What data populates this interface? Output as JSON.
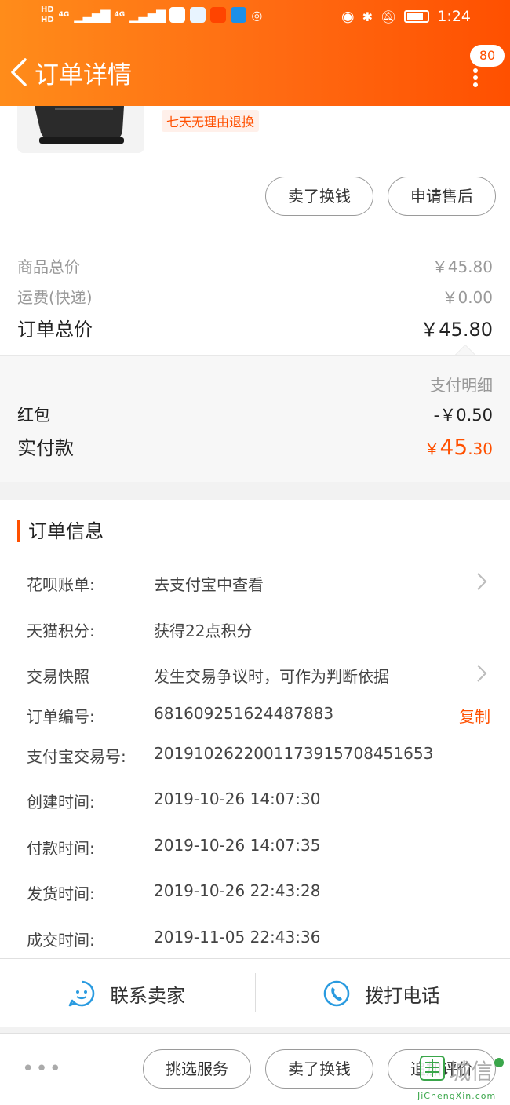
{
  "status_bar": {
    "hd_top": "HD",
    "hd_bottom": "HD",
    "net1": "4G",
    "net2": "4G",
    "time": "1:24",
    "colors": {
      "bar_start": "#ff8c1a",
      "bar_end": "#ff5000"
    }
  },
  "header": {
    "title": "订单详情",
    "badge_count": "80",
    "back_icon": "chevron-left-icon",
    "more_icon": "more-vertical-icon"
  },
  "product": {
    "return_tag": "七天无理由退换",
    "sell_button": "卖了换钱",
    "after_sale_button": "申请售后"
  },
  "prices": {
    "goods_total_label": "商品总价",
    "goods_total_value": "￥45.80",
    "shipping_label": "运费(快递)",
    "shipping_value": "￥0.00",
    "order_total_label": "订单总价",
    "order_total_value": "￥45.80",
    "pay_detail_link": "支付明细",
    "red_packet_label": "红包",
    "red_packet_value": "-￥0.50",
    "actual_label": "实付款",
    "actual_currency": "￥",
    "actual_integer": "45",
    "actual_decimal": ".30",
    "accent_color": "#ff5000"
  },
  "order_info": {
    "title": "订单信息",
    "rows": [
      {
        "label": "花呗账单:",
        "value": "去支付宝中查看"
      },
      {
        "label": "天猫积分:",
        "value": "获得22点积分"
      },
      {
        "label": "交易快照",
        "value": "发生交易争议时，可作为判断依据"
      },
      {
        "label": "订单编号:",
        "value": "681609251624487883"
      },
      {
        "label": "支付宝交易号:",
        "value": "2019102622001173915708451653"
      },
      {
        "label": "创建时间:",
        "value": "2019-10-26 14:07:30"
      },
      {
        "label": "付款时间:",
        "value": "2019-10-26 14:07:35"
      },
      {
        "label": "发货时间:",
        "value": "2019-10-26 22:43:28"
      },
      {
        "label": "成交时间:",
        "value": "2019-11-05 22:43:36"
      }
    ],
    "copy_label": "复制"
  },
  "contact": {
    "seller_label": "联系卖家",
    "phone_label": "拨打电话",
    "icon_color": "#2a9be0"
  },
  "bottom_bar": {
    "more_dots": "•••",
    "service_button": "挑选服务",
    "sell_button": "卖了换钱",
    "review_button": "追加评价"
  },
  "watermark": {
    "text": "城信",
    "url_text": "JiChengXin.com"
  }
}
